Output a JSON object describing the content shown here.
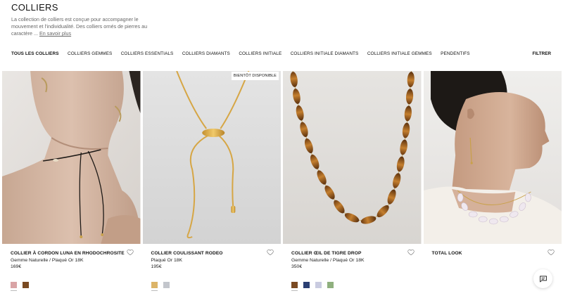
{
  "header": {
    "title": "COLLIERS",
    "intro": "La collection de colliers est conçue pour accompagner le mouvement et l'individualité. Des colliers ornés de pierres au caractère ...",
    "more_link": "En savoir plus"
  },
  "nav": {
    "items": [
      {
        "label": "TOUS LES COLLIERS",
        "active": true
      },
      {
        "label": "COLLIERS GEMMES"
      },
      {
        "label": "COLLIERS ESSENTIALS"
      },
      {
        "label": "COLLIERS DIAMANTS"
      },
      {
        "label": "COLLIERS INITIALE"
      },
      {
        "label": "COLLIERS INITIALE DIAMANTS"
      },
      {
        "label": "COLLIERS INITIALE GEMMES"
      },
      {
        "label": "PENDENTIFS"
      }
    ],
    "filter_label": "FILTRER"
  },
  "products": [
    {
      "name": "COLLIER À CORDON LUNA EN RHODOCHROSITE",
      "subtitle": "Gemme Naturelle / Plaqué Or 18K",
      "price": "169€",
      "image": "model-black-cord-necklace",
      "swatches": [
        "#d9a4a6",
        "#7a4a22"
      ]
    },
    {
      "name": "COLLIER COULISSANT RODEO",
      "subtitle": "Plaqué Or 18K",
      "price": "195€",
      "badge": "BIENTÔT DISPONIBLE",
      "image": "gold-snake-chain-necklace",
      "swatches": [
        "#dcb468",
        "#c3c6cc"
      ]
    },
    {
      "name": "COLLIER ŒIL DE TIGRE DROP",
      "subtitle": "Gemme Naturelle / Plaqué Or 18K",
      "price": "350€",
      "image": "tiger-eye-bead-necklace",
      "swatches": [
        "#7a4a22",
        "#2b3f73",
        "#c9cbe0",
        "#8fb07e"
      ]
    },
    {
      "name": "TOTAL LOOK",
      "subtitle": "",
      "price": "",
      "image": "model-profile-pearl-necklace",
      "swatches": []
    }
  ],
  "icons": {
    "heart": "heart-icon",
    "chat": "chat-icon"
  }
}
